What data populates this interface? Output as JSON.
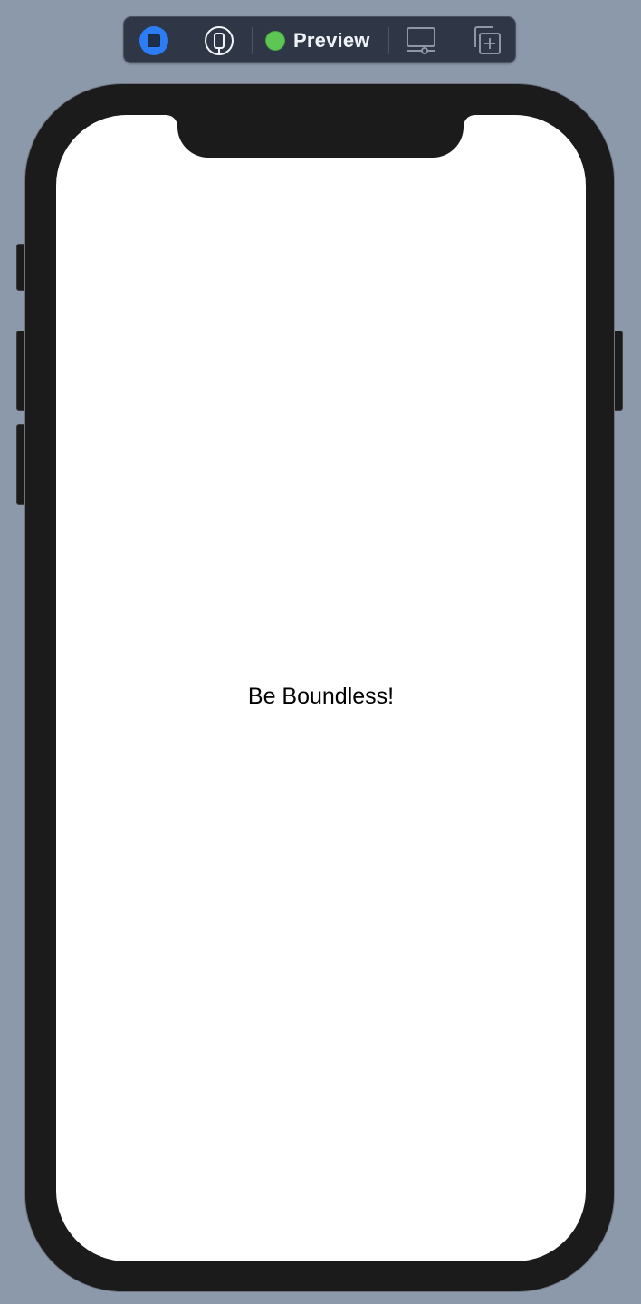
{
  "toolbar": {
    "live_icon": "stop-square-icon",
    "device_icon": "iphone-icon",
    "preview_label": "Preview",
    "preview_status_color": "#5ec654",
    "settings_icon": "device-settings-icon",
    "duplicate_icon": "duplicate-preview-icon"
  },
  "colors": {
    "background": "#8c99ab",
    "toolbar": "#2f3747",
    "live_accent": "#2c7cf6",
    "device_frame": "#1b1b1b",
    "screen": "#ffffff"
  },
  "screen": {
    "text": "Be Boundless!"
  }
}
